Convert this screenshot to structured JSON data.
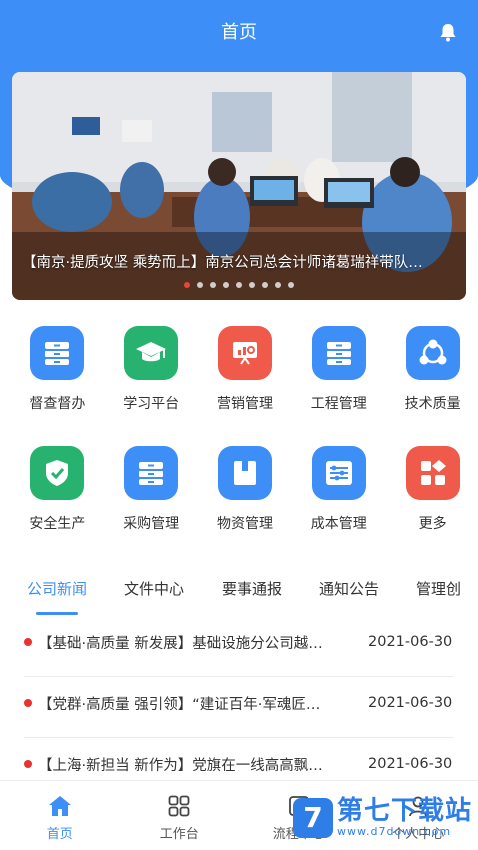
{
  "header": {
    "title": "首页",
    "bell_icon": "bell-icon"
  },
  "banner": {
    "caption": "【南京·提质攻坚 乘势而上】南京公司总会计师诸葛瑞祥带队…",
    "slide_count": 9,
    "active_slide": 0
  },
  "apps": {
    "row1": [
      {
        "label": "督查督办",
        "icon": "folder-stack-icon",
        "color": "#3d8ef7"
      },
      {
        "label": "学习平台",
        "icon": "graduation-cap-icon",
        "color": "#27b36f"
      },
      {
        "label": "营销管理",
        "icon": "presentation-chart-icon",
        "color": "#ef5a4a"
      },
      {
        "label": "工程管理",
        "icon": "folder-stack-icon",
        "color": "#3d8ef7"
      },
      {
        "label": "技术质量",
        "icon": "network-icon",
        "color": "#3d8ef7"
      }
    ],
    "row2": [
      {
        "label": "安全生产",
        "icon": "shield-check-icon",
        "color": "#27b36f"
      },
      {
        "label": "采购管理",
        "icon": "folder-stack-icon",
        "color": "#3d8ef7"
      },
      {
        "label": "物资管理",
        "icon": "box-icon",
        "color": "#3d8ef7"
      },
      {
        "label": "成本管理",
        "icon": "abacus-icon",
        "color": "#3d8ef7"
      },
      {
        "label": "更多",
        "icon": "more-grid-icon",
        "color": "#ef5a4a"
      }
    ]
  },
  "tabs": [
    "公司新闻",
    "文件中心",
    "要事通报",
    "通知公告",
    "管理创"
  ],
  "news": [
    {
      "title": "【基础·高质量 新发展】基础设施分公司越…",
      "date": "2021-06-30"
    },
    {
      "title": "【党群·高质量 强引领】“建证百年·军魂匠…",
      "date": "2021-06-30"
    },
    {
      "title": "【上海·新担当 新作为】党旗在一线高高飘…",
      "date": "2021-06-30"
    }
  ],
  "bottom_nav": [
    {
      "label": "首页",
      "icon": "home-icon"
    },
    {
      "label": "工作台",
      "icon": "grid-icon"
    },
    {
      "label": "流程中心",
      "icon": "flow-icon"
    },
    {
      "label": "个人中心",
      "icon": "user-icon"
    }
  ],
  "watermark": {
    "logo": "7",
    "main": "第七下载站",
    "sub": "www.d7down.com"
  },
  "colors": {
    "primary": "#3d8ef7",
    "green": "#27b36f",
    "red": "#ef5a4a",
    "news_bullet": "#e8332e"
  }
}
